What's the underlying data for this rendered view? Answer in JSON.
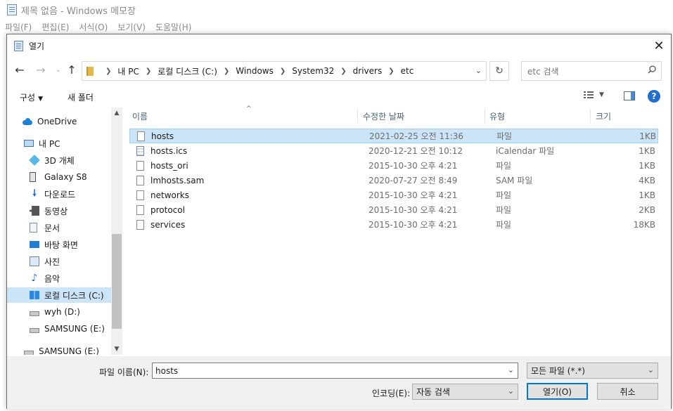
{
  "notepad": {
    "title": "제목 없음 - Windows 메모장",
    "menu": [
      "파일(F)",
      "편집(E)",
      "서식(O)",
      "보기(V)",
      "도움말(H)"
    ]
  },
  "dialog": {
    "title": "열기",
    "close_glyph": "✕",
    "address": {
      "crumbs": [
        "내 PC",
        "로컬 디스크 (C:)",
        "Windows",
        "System32",
        "drivers",
        "etc"
      ]
    },
    "search": {
      "placeholder": "etc 검색"
    },
    "toolbar": {
      "organize": "구성",
      "new_folder": "새 폴더",
      "help": "?"
    },
    "nav_items": [
      {
        "label": "OneDrive",
        "icon": "onedrive-icon"
      },
      {
        "label": "내 PC",
        "icon": "pc-icon"
      },
      {
        "label": "3D 개체",
        "icon": "3d-objects-icon"
      },
      {
        "label": "Galaxy S8",
        "icon": "phone-icon"
      },
      {
        "label": "다운로드",
        "icon": "download-icon"
      },
      {
        "label": "동영상",
        "icon": "video-icon"
      },
      {
        "label": "문서",
        "icon": "document-icon"
      },
      {
        "label": "바탕 화면",
        "icon": "desktop-icon"
      },
      {
        "label": "사진",
        "icon": "picture-icon"
      },
      {
        "label": "음악",
        "icon": "music-icon"
      },
      {
        "label": "로컬 디스크 (C:)",
        "icon": "local-disk-icon",
        "selected": true
      },
      {
        "label": "wyh (D:)",
        "icon": "drive-icon"
      },
      {
        "label": "SAMSUNG (E:)",
        "icon": "drive-icon"
      },
      {
        "label": "SAMSUNG (E:)",
        "icon": "drive-icon"
      }
    ],
    "columns": {
      "name": "이름",
      "date": "수정한 날짜",
      "type": "유형",
      "size": "크기"
    },
    "files": [
      {
        "name": "hosts",
        "date": "2021-02-25 오전 11:36",
        "type": "파일",
        "size": "1KB",
        "selected": true
      },
      {
        "name": "hosts.ics",
        "date": "2020-12-21 오전 10:12",
        "type": "iCalendar 파일",
        "size": "1KB"
      },
      {
        "name": "hosts_ori",
        "date": "2015-10-30 오후 4:21",
        "type": "파일",
        "size": "1KB"
      },
      {
        "name": "lmhosts.sam",
        "date": "2020-07-27 오전 8:49",
        "type": "SAM 파일",
        "size": "4KB"
      },
      {
        "name": "networks",
        "date": "2015-10-30 오후 4:21",
        "type": "파일",
        "size": "1KB"
      },
      {
        "name": "protocol",
        "date": "2015-10-30 오후 4:21",
        "type": "파일",
        "size": "2KB"
      },
      {
        "name": "services",
        "date": "2015-10-30 오후 4:21",
        "type": "파일",
        "size": "18KB"
      }
    ],
    "bottom": {
      "filename_label": "파일 이름(N):",
      "filename_value": "hosts",
      "filter_value": "모든 파일 (*.*)",
      "encoding_label": "인코딩(E):",
      "encoding_value": "자동 검색",
      "open_button": "열기(O)",
      "cancel_button": "취소"
    }
  }
}
